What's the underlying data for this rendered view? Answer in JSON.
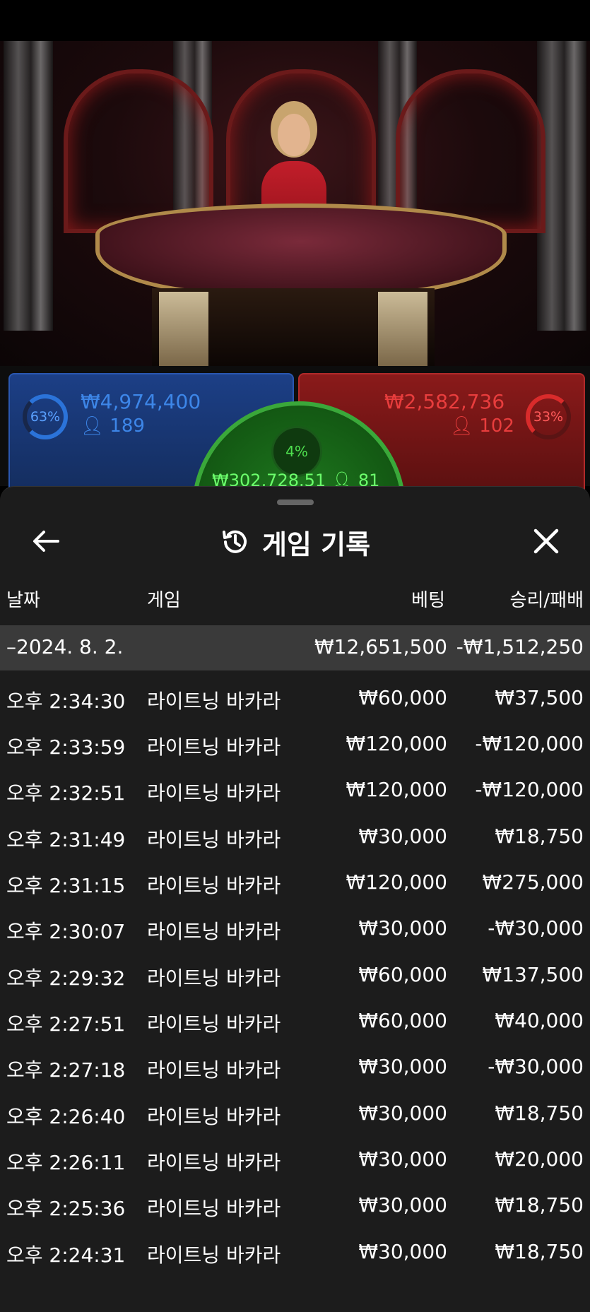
{
  "bet_panels": {
    "player": {
      "percent": "63%",
      "amount": "₩4,974,400",
      "players": "189"
    },
    "tie": {
      "percent": "4%",
      "amount": "₩302,728.51",
      "players": "81"
    },
    "banker": {
      "percent": "33%",
      "amount": "₩2,582,736",
      "players": "102"
    }
  },
  "history": {
    "title": "게임 기록",
    "icons": {
      "back": "back-arrow-icon",
      "history": "history-icon",
      "close": "close-icon",
      "user": "user-icon"
    },
    "columns": {
      "date": "날짜",
      "game": "게임",
      "bet": "베팅",
      "result": "승리/패배"
    },
    "summary": {
      "date": "–2024. 8. 2.",
      "bet": "₩12,651,500",
      "result": "-₩1,512,250"
    },
    "rows": [
      {
        "time": "오후 2:34:30",
        "game": "라이트닝 바카라",
        "bet": "₩60,000",
        "result": "₩37,500"
      },
      {
        "time": "오후 2:33:59",
        "game": "라이트닝 바카라",
        "bet": "₩120,000",
        "result": "-₩120,000"
      },
      {
        "time": "오후 2:32:51",
        "game": "라이트닝 바카라",
        "bet": "₩120,000",
        "result": "-₩120,000"
      },
      {
        "time": "오후 2:31:49",
        "game": "라이트닝 바카라",
        "bet": "₩30,000",
        "result": "₩18,750"
      },
      {
        "time": "오후 2:31:15",
        "game": "라이트닝 바카라",
        "bet": "₩120,000",
        "result": "₩275,000"
      },
      {
        "time": "오후 2:30:07",
        "game": "라이트닝 바카라",
        "bet": "₩30,000",
        "result": "-₩30,000"
      },
      {
        "time": "오후 2:29:32",
        "game": "라이트닝 바카라",
        "bet": "₩60,000",
        "result": "₩137,500"
      },
      {
        "time": "오후 2:27:51",
        "game": "라이트닝 바카라",
        "bet": "₩60,000",
        "result": "₩40,000"
      },
      {
        "time": "오후 2:27:18",
        "game": "라이트닝 바카라",
        "bet": "₩30,000",
        "result": "-₩30,000"
      },
      {
        "time": "오후 2:26:40",
        "game": "라이트닝 바카라",
        "bet": "₩30,000",
        "result": "₩18,750"
      },
      {
        "time": "오후 2:26:11",
        "game": "라이트닝 바카라",
        "bet": "₩30,000",
        "result": "₩20,000"
      },
      {
        "time": "오후 2:25:36",
        "game": "라이트닝 바카라",
        "bet": "₩30,000",
        "result": "₩18,750"
      },
      {
        "time": "오후 2:24:31",
        "game": "라이트닝 바카라",
        "bet": "₩30,000",
        "result": "₩18,750"
      }
    ]
  }
}
